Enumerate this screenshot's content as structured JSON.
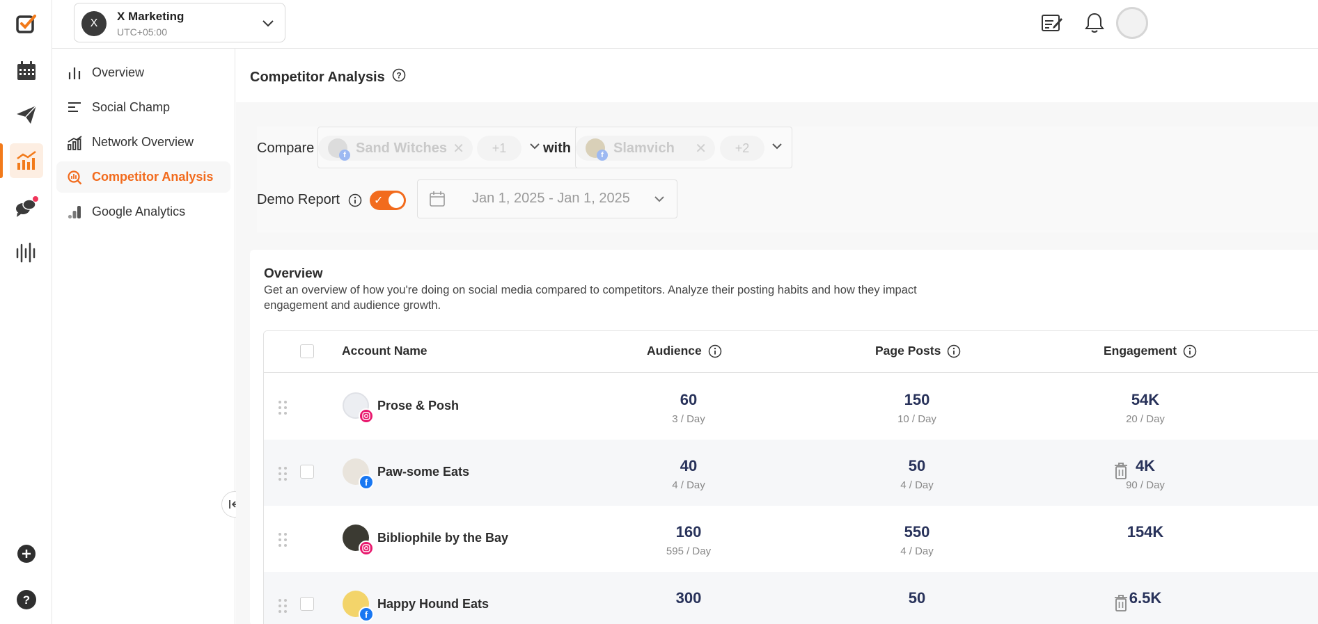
{
  "header": {
    "account": {
      "initial": "X",
      "name": "X Marketing",
      "timezone": "UTC+05:00"
    }
  },
  "rail": {
    "icons": [
      "logo-icon",
      "calendar-icon",
      "send-icon",
      "analytics-icon",
      "chat-icon",
      "audio-wave-icon",
      "add-icon",
      "help-icon"
    ],
    "active": "analytics-icon",
    "accent": "#f27a1a"
  },
  "subnav": {
    "items": [
      {
        "label": "Overview",
        "icon": "bar-chart-icon"
      },
      {
        "label": "Social Champ",
        "icon": "align-left-icon"
      },
      {
        "label": "Network Overview",
        "icon": "network-chart-icon"
      },
      {
        "label": "Competitor Analysis",
        "icon": "competitor-icon",
        "active": true
      },
      {
        "label": "Google Analytics",
        "icon": "google-analytics-icon"
      }
    ]
  },
  "page": {
    "title": "Competitor Analysis",
    "compare_label": "Compare",
    "with_label": "with",
    "compare_chip": "Sand Witches",
    "compare_more": "+1",
    "with_chip": "Slamvich",
    "with_more": "+2",
    "demo_label": "Demo Report",
    "demo_enabled": true,
    "date_range": "Jan 1, 2025 - Jan 1, 2025"
  },
  "overview": {
    "title": "Overview",
    "description": "Get an overview of how you're doing on social media compared to competitors. Analyze their posting habits and how they impact engagement and audience growth.",
    "columns": [
      "Account Name",
      "Audience",
      "Page Posts",
      "Engagement"
    ],
    "rows": [
      {
        "name": "Prose & Posh",
        "network": "instagram",
        "audience": "60",
        "audience_rate": "3 / Day",
        "posts": "150",
        "posts_rate": "10 / Day",
        "engagement": "54K",
        "engagement_rate": "20 / Day"
      },
      {
        "name": "Paw-some Eats",
        "network": "facebook",
        "audience": "40",
        "audience_rate": "4 / Day",
        "posts": "50",
        "posts_rate": "4 / Day",
        "engagement": "4K",
        "engagement_rate": "90 / Day"
      },
      {
        "name": "Bibliophile by the Bay",
        "network": "instagram",
        "audience": "160",
        "audience_rate": "595 / Day",
        "posts": "550",
        "posts_rate": "4 / Day",
        "engagement": "154K",
        "engagement_rate": ""
      },
      {
        "name": "Happy Hound Eats",
        "network": "facebook",
        "audience": "300",
        "audience_rate": "",
        "posts": "50",
        "posts_rate": "",
        "engagement": "6.5K",
        "engagement_rate": ""
      }
    ]
  }
}
